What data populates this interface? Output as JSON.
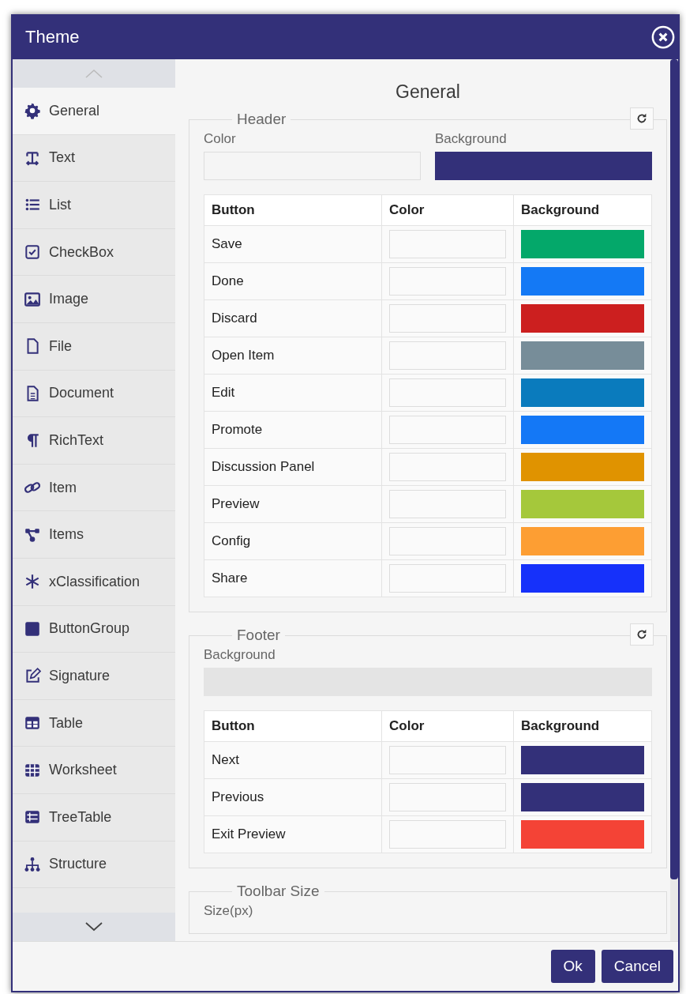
{
  "window": {
    "title": "Theme"
  },
  "sidebar": {
    "items": [
      {
        "label": "General",
        "selected": true
      },
      {
        "label": "Text",
        "selected": false
      },
      {
        "label": "List",
        "selected": false
      },
      {
        "label": "CheckBox",
        "selected": false
      },
      {
        "label": "Image",
        "selected": false
      },
      {
        "label": "File",
        "selected": false
      },
      {
        "label": "Document",
        "selected": false
      },
      {
        "label": "RichText",
        "selected": false
      },
      {
        "label": "Item",
        "selected": false
      },
      {
        "label": "Items",
        "selected": false
      },
      {
        "label": "xClassification",
        "selected": false
      },
      {
        "label": "ButtonGroup",
        "selected": false
      },
      {
        "label": "Signature",
        "selected": false
      },
      {
        "label": "Table",
        "selected": false
      },
      {
        "label": "Worksheet",
        "selected": false
      },
      {
        "label": "TreeTable",
        "selected": false
      },
      {
        "label": "Structure",
        "selected": false
      }
    ]
  },
  "panel": {
    "title": "General",
    "header": {
      "legend": "Header",
      "color_label": "Color",
      "background_label": "Background",
      "background": {
        "color": "#333079"
      },
      "table": {
        "columns": [
          "Button",
          "Color",
          "Background"
        ],
        "rows": [
          {
            "button": "Save",
            "color": "#04a86a"
          },
          {
            "button": "Done",
            "color": "#1479f5"
          },
          {
            "button": "Discard",
            "color": "#cc1f1f"
          },
          {
            "button": "Open Item",
            "color": "#778d99"
          },
          {
            "button": "Edit",
            "color": "#0a7bbd"
          },
          {
            "button": "Promote",
            "color": "#1478f6"
          },
          {
            "button": "Discussion Panel",
            "color": "#e09300"
          },
          {
            "button": "Preview",
            "color": "#a5c83b"
          },
          {
            "button": "Config",
            "color": "#fd9e33"
          },
          {
            "button": "Share",
            "color": "#1631fa"
          }
        ]
      }
    },
    "footer": {
      "legend": "Footer",
      "background_label": "Background",
      "background": {
        "color": "#e4e4e4"
      },
      "table": {
        "columns": [
          "Button",
          "Color",
          "Background"
        ],
        "rows": [
          {
            "button": "Next",
            "color": "#333079"
          },
          {
            "button": "Previous",
            "color": "#333079"
          },
          {
            "button": "Exit Preview",
            "color": "#f44336"
          }
        ]
      }
    },
    "toolbar_size": {
      "legend": "Toolbar Size",
      "size_label": "Size(px)"
    }
  },
  "buttons": [
    "Ok",
    "Cancel"
  ]
}
